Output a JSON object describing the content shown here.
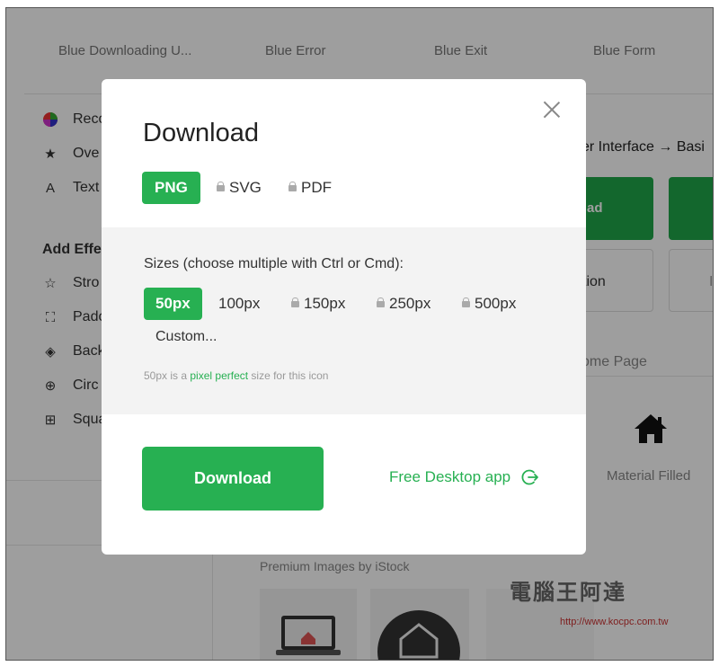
{
  "background": {
    "top_tabs": [
      "Blue Downloading U...",
      "Blue Error",
      "Blue Exit",
      "Blue Form"
    ],
    "sidebar": {
      "items_top": [
        {
          "label": "Reco",
          "icon": "color-wheel-icon"
        },
        {
          "label": "Ove",
          "icon": "stars-icon"
        },
        {
          "label": "Text",
          "icon": "text-icon"
        }
      ],
      "section_title": "Add Effe",
      "items_effects": [
        {
          "label": "Stro",
          "icon": "star-outline-icon"
        },
        {
          "label": "Pado",
          "icon": "padding-icon"
        },
        {
          "label": "Back",
          "icon": "paint-bucket-icon"
        },
        {
          "label": "Circ",
          "icon": "circle-icon"
        },
        {
          "label": "Squa",
          "icon": "square-icon"
        }
      ]
    },
    "breadcrumb": "er Interface → Basi",
    "green_button_text": "ad",
    "white_button_text": "tion",
    "white_button2_text": "I",
    "home_page_label": "ome Page",
    "material_label": "Material Filled",
    "premium_label": "Premium Images by iStock",
    "watermark_text": "電腦王阿達",
    "watermark_url": "http://www.kocpc.com.tw"
  },
  "modal": {
    "title": "Download",
    "formats": [
      {
        "label": "PNG",
        "active": true,
        "locked": false
      },
      {
        "label": "SVG",
        "active": false,
        "locked": true
      },
      {
        "label": "PDF",
        "active": false,
        "locked": true
      }
    ],
    "sizes_label": "Sizes (choose multiple with Ctrl or Cmd):",
    "sizes": [
      {
        "label": "50px",
        "active": true,
        "locked": false
      },
      {
        "label": "100px",
        "active": false,
        "locked": false
      },
      {
        "label": "150px",
        "active": false,
        "locked": true
      },
      {
        "label": "250px",
        "active": false,
        "locked": true
      },
      {
        "label": "500px",
        "active": false,
        "locked": true
      }
    ],
    "custom_label": "Custom...",
    "note": {
      "prefix": "50px is a",
      "link": "pixel perfect",
      "suffix": "size for this icon"
    },
    "download_button": "Download",
    "desktop_app_link": "Free Desktop app"
  },
  "colors": {
    "accent": "#27b052",
    "overlay": "rgba(0,0,0,0.38)"
  }
}
